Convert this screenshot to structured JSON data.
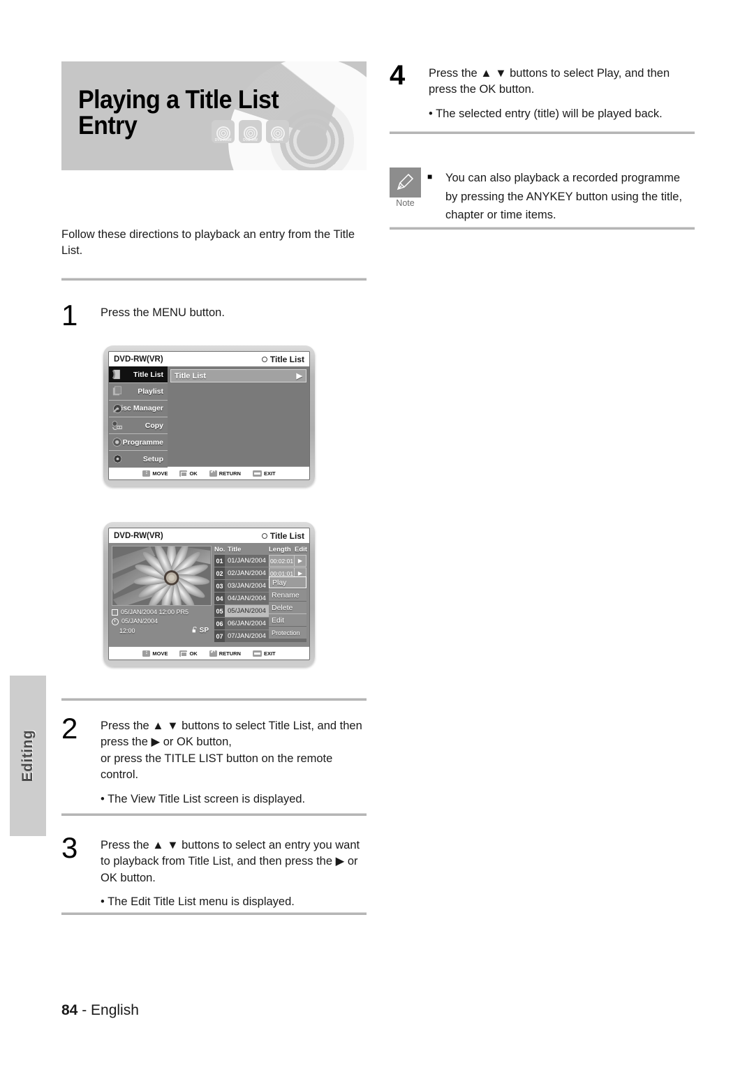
{
  "page": {
    "title": "Playing a Title List Entry",
    "intro": "Follow these directions to playback an entry from the Title List.",
    "footer_number": "84",
    "footer_dash": " - ",
    "footer_language": "English",
    "side_tab": "Editing"
  },
  "disc_badges": [
    {
      "label": "DVD-RAM",
      "name": "dvd-ram-badge"
    },
    {
      "label": "DVD-RW",
      "name": "dvd-rw-badge"
    },
    {
      "label": "DVD-R",
      "name": "dvd-r-badge"
    }
  ],
  "steps": [
    {
      "number": "1",
      "text": "Press the MENU button.",
      "sub": ""
    },
    {
      "number": "2",
      "text": "Press the ▲ ▼ buttons to select Title List, and then press the ▶ or OK button,\nor press the TITLE LIST button on the remote control.",
      "sub": "• The View Title List screen is displayed."
    },
    {
      "number": "3",
      "text": "Press the ▲ ▼ buttons to select an entry you want to playback from Title List, and then press the ▶ or OK button.",
      "sub": "• The Edit Title List menu is displayed."
    },
    {
      "number": "4",
      "text": "Press the ▲ ▼ buttons to select Play, and then press the OK button.",
      "sub": "• The selected entry (title) will be played back."
    }
  ],
  "note": {
    "caption": "Note",
    "bullet": "■",
    "text": "You can also playback a recorded programme by pressing the ANYKEY button using the title, chapter or time items."
  },
  "osd_menu_screen": {
    "disc_type": "DVD-RW(VR)",
    "header_right": "Title List",
    "sidebar": [
      {
        "label": "Title List",
        "selected": true,
        "icon": "title-list-icon"
      },
      {
        "label": "Playlist",
        "selected": false,
        "icon": "playlist-icon"
      },
      {
        "label": "Disc Manager",
        "selected": false,
        "icon": "disc-manager-icon"
      },
      {
        "label": "Copy",
        "selected": false,
        "icon": "copy-icon"
      },
      {
        "label": "Programme",
        "selected": false,
        "icon": "programme-icon"
      },
      {
        "label": "Setup",
        "selected": false,
        "icon": "setup-icon"
      }
    ],
    "content_row": "Title List",
    "content_row_arrow": "▶",
    "footer_buttons": [
      {
        "label": "MOVE",
        "icon": "dpad-icon"
      },
      {
        "label": "OK",
        "icon": "ok-icon"
      },
      {
        "label": "RETURN",
        "icon": "return-icon"
      },
      {
        "label": "EXIT",
        "icon": "exit-icon"
      }
    ]
  },
  "osd_titlelist_screen": {
    "disc_type": "DVD-RW(VR)",
    "header_right": "Title List",
    "thumb_info": {
      "line1": "05/JAN/2004 12:00 PR5",
      "line2": "05/JAN/2004",
      "line3_time": "12:00",
      "line3_mode": "SP",
      "lock_icon": "unlock-icon"
    },
    "columns": {
      "no": "No.",
      "title": "Title",
      "length": "Length",
      "edit": "Edit"
    },
    "rows": [
      {
        "no": "01",
        "title": "01/JAN/2004",
        "length": "00:02:01",
        "edit": "▶",
        "highlight": false
      },
      {
        "no": "02",
        "title": "02/JAN/2004",
        "length": "00:01:01",
        "edit": "▶",
        "highlight": false
      },
      {
        "no": "03",
        "title": "03/JAN/2004",
        "length": "",
        "edit": "",
        "highlight": false
      },
      {
        "no": "04",
        "title": "04/JAN/2004",
        "length": "",
        "edit": "",
        "highlight": false
      },
      {
        "no": "05",
        "title": "05/JAN/2004",
        "length": "",
        "edit": "",
        "highlight": true
      },
      {
        "no": "06",
        "title": "06/JAN/2004",
        "length": "",
        "edit": "",
        "highlight": false
      },
      {
        "no": "07",
        "title": "07/JAN/2004",
        "length": "",
        "edit": "",
        "highlight": false
      }
    ],
    "popup": [
      {
        "label": "Play",
        "selected": true
      },
      {
        "label": "Rename",
        "selected": false
      },
      {
        "label": "Delete",
        "selected": false
      },
      {
        "label": "Edit",
        "selected": false
      },
      {
        "label": "Protection",
        "selected": false
      }
    ],
    "footer_buttons": [
      {
        "label": "MOVE",
        "icon": "dpad-icon"
      },
      {
        "label": "OK",
        "icon": "ok-icon"
      },
      {
        "label": "RETURN",
        "icon": "return-icon"
      },
      {
        "label": "EXIT",
        "icon": "exit-icon"
      }
    ]
  },
  "colors": {
    "banner_bg": "#c6c6c6",
    "rule": "#b5b5b5",
    "osd_bg": "#8a8a8a",
    "osd_selected": "#111111",
    "side_tab_bg": "#cdcdcd"
  }
}
